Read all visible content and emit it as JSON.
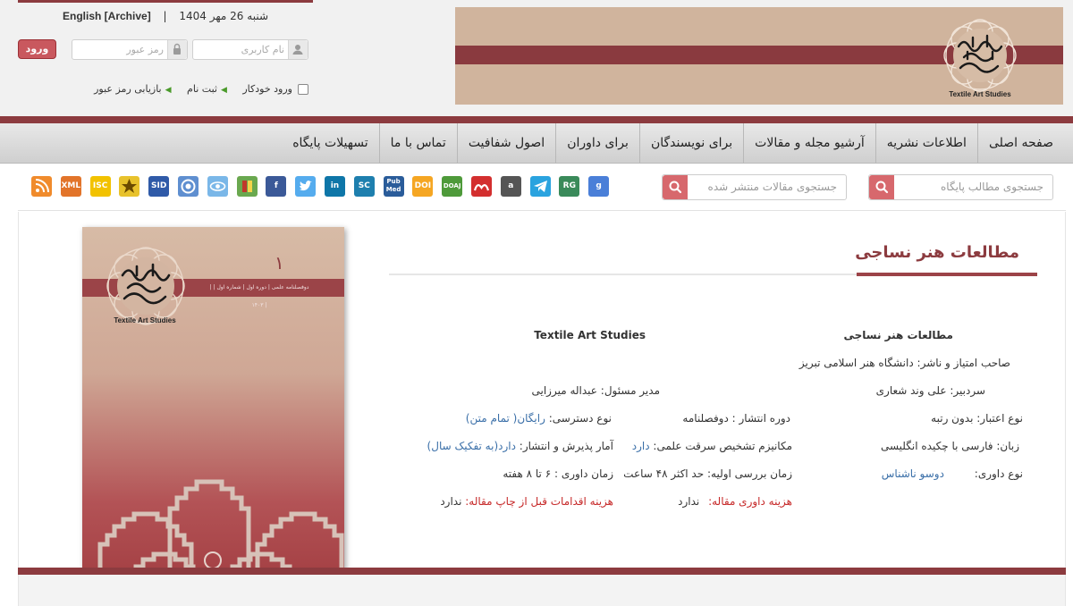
{
  "header": {
    "lang_link": "[Archive] English",
    "separator": "|",
    "date": "شنبه 26 مهر 1404",
    "login_button": "ورود",
    "password_placeholder": "رمز عبور",
    "username_placeholder": "نام کاربری",
    "remember_me": "ورود خودکار",
    "register": "ثبت نام",
    "forgot_password": "بازیابی رمز عبور",
    "banner_logo_subtitle": "Textile Art Studies"
  },
  "nav": {
    "items": [
      "صفحه اصلی",
      "اطلاعات نشریه",
      "آرشیو مجله و مقالات",
      "برای نویسندگان",
      "برای داوران",
      "اصول شفافیت",
      "تماس با ما",
      "تسهیلات پایگاه"
    ]
  },
  "search": {
    "site_placeholder": "جستجوی مطالب پایگاه",
    "articles_placeholder": "جستجوی مقالات منتشر شده"
  },
  "indexing_icons": [
    {
      "name": "rss-icon",
      "label": "",
      "color": "#f08b2c"
    },
    {
      "name": "xml-icon",
      "label": "XML",
      "color": "#e2742a"
    },
    {
      "name": "isc-icon",
      "label": "ISC",
      "color": "#f2c200"
    },
    {
      "name": "star-logo-icon",
      "label": "",
      "color": "#e8c22c"
    },
    {
      "name": "sid-icon",
      "label": "SID",
      "color": "#2f5aa8"
    },
    {
      "name": "magiran-icon",
      "label": "",
      "color": "#5f8fd0"
    },
    {
      "name": "eye-icon",
      "label": "",
      "color": "#7ab7e8"
    },
    {
      "name": "book-icon",
      "label": "",
      "color": "#6aa84f"
    },
    {
      "name": "facebook-icon",
      "label": "f",
      "color": "#3b5998"
    },
    {
      "name": "twitter-icon",
      "label": "",
      "color": "#55acee"
    },
    {
      "name": "linkedin-icon",
      "label": "in",
      "color": "#0e76a8"
    },
    {
      "name": "scopus-icon",
      "label": "SC",
      "color": "#1e7fae"
    },
    {
      "name": "pubmed-icon",
      "label": "Pub Med",
      "color": "#2a5c9a"
    },
    {
      "name": "doi-icon",
      "label": "DOI",
      "color": "#f5a623"
    },
    {
      "name": "doaj-icon",
      "label": "DOAJ",
      "color": "#4e9a3a"
    },
    {
      "name": "mendeley-icon",
      "label": "",
      "color": "#d32f2f"
    },
    {
      "name": "academia-icon",
      "label": "a",
      "color": "#555555"
    },
    {
      "name": "telegram-icon",
      "label": "",
      "color": "#2aa3df"
    },
    {
      "name": "researchgate-icon",
      "label": "RG",
      "color": "#3a8a5a"
    },
    {
      "name": "google-scholar-icon",
      "label": "g",
      "color": "#4a7fd8"
    }
  ],
  "cover": {
    "subtitle": "Textile Art Studies",
    "band_text": "| دوفصلنامه علمی | دوره اول | شماره اول | ۱۴۰۳ |",
    "issue_number": "۱"
  },
  "journal": {
    "title": "مطالعات هنر نساجی",
    "name_fa": "مطالعات هنر نساجی",
    "name_en": "Textile Art Studies",
    "publisher_label": "صاحب امتیاز و ناشر:",
    "publisher_value": "دانشگاه هنر اسلامی تبریز",
    "editor_label": "سردبیر:",
    "editor_value": "علی وند شعاری",
    "manager_label": "مدیر مسئول:",
    "manager_value": "عبداله میرزایی",
    "credit_label": "نوع اعتبار:",
    "credit_value": "بدون رتبه",
    "period_label": "دوره انتشار :",
    "period_value": "دوفصلنامه",
    "access_label": "نوع دسترسی:",
    "access_value": "رایگان( تمام متن)",
    "language_label": "زبان:",
    "language_value": "فارسی با چکیده انگلیسی",
    "plagiarism_label": "مکانیزم تشخیص سرقت علمی:",
    "plagiarism_value": "دارد",
    "stats_label": "آمار پذیرش و انتشار:",
    "stats_value": "دارد(به تفکیک سال)",
    "review_type_label": "نوع داوری:",
    "review_type_value": "دوسو ناشناس",
    "initial_review_label": "زمان بررسی اولیه:",
    "initial_review_value": "حد اکثر ۴۸ ساعت",
    "review_time_label": "زمان داوری :",
    "review_time_value": "۶ تا ۸ هفته",
    "review_fee_label": "هزینه داوری مقاله:",
    "review_fee_value": "ندارد",
    "print_fee_label": "هزینه اقدامات قبل از چاپ مقاله:",
    "print_fee_value": "ندارد"
  }
}
